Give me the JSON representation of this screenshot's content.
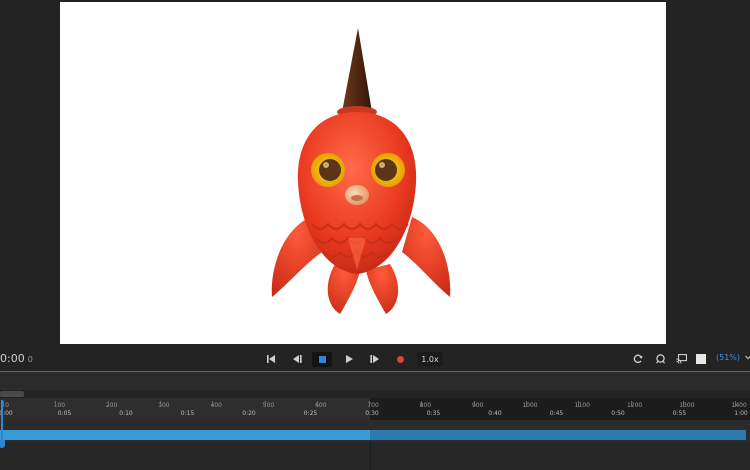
{
  "transport": {
    "timecode": "0:00",
    "frame": "0",
    "speed": "1.0x",
    "zoom": "(51%)",
    "playing": false
  },
  "timeline": {
    "frame_markers": [
      "0",
      "100",
      "200",
      "300",
      "400",
      "500",
      "600",
      "700",
      "800",
      "900",
      "1000",
      "1100",
      "1200",
      "1300",
      "1400"
    ],
    "time_markers": [
      "0:00",
      "0:05",
      "0:10",
      "0:15",
      "0:20",
      "0:25",
      "0:30",
      "0:35",
      "0:40",
      "0:45",
      "0:50",
      "0:55",
      "1:00"
    ],
    "work_area_end_frame": 700
  },
  "canvas": {
    "subject": "red fish character with brown cone horn",
    "background": "#ffffff"
  },
  "colors": {
    "accent": "#2f86d8",
    "track": "#3a9ad6",
    "record": "#e04040"
  }
}
